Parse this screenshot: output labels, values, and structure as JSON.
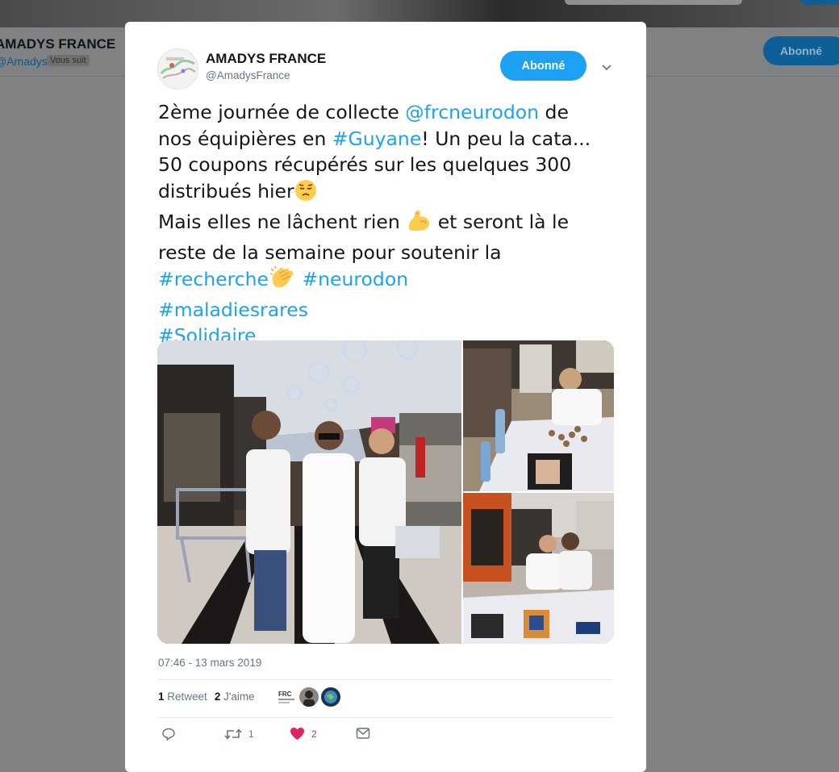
{
  "background": {
    "profile_name": "AMADYS FRANCE",
    "profile_handle": "@AmadysFrance",
    "follows_you": "Vous suit",
    "follow_button": "Abonné"
  },
  "tweet": {
    "author": {
      "name": "AMADYS FRANCE",
      "handle": "@AmadysFrance",
      "avatar_icon": "avatar-map-logo"
    },
    "follow_button": "Abonné",
    "lines": [
      [
        {
          "t": "2ème journée de collecte "
        },
        {
          "t": "@frcneurodon",
          "link": true
        },
        {
          "t": "  de"
        }
      ],
      [
        {
          "t": "nos équipières en "
        },
        {
          "t": "#Guyane",
          "link": true
        },
        {
          "t": "! Un peu la cata..."
        }
      ],
      [
        {
          "t": "50 coupons récupérés sur les quelques 300"
        }
      ],
      [
        {
          "t": "distribués hier"
        },
        {
          "emoji": "pensive-face"
        }
      ],
      [
        {
          "t": "Mais elles ne lâchent rien "
        },
        {
          "emoji": "flexed-biceps"
        },
        {
          "t": " et seront là le"
        }
      ],
      [
        {
          "t": "reste de la semaine pour soutenir la"
        }
      ],
      [
        {
          "t": "#recherche",
          "link": true
        },
        {
          "emoji": "clapping-hands"
        },
        {
          "t": " "
        },
        {
          "t": "#neurodon",
          "link": true
        }
      ],
      [
        {
          "t": "#maladiesrares",
          "link": true
        }
      ],
      [
        {
          "t": "#Solidaire",
          "link": true
        }
      ]
    ],
    "timestamp": "07:46 - 13 mars 2019",
    "stats": {
      "retweets_count": "1",
      "retweets_label": "Retweet",
      "likes_count": "2",
      "likes_label": "J'aime"
    },
    "liker_avatars": [
      "frc-logo",
      "person-avatar",
      "globe-avatar"
    ],
    "actions": {
      "reply_icon": "reply-icon",
      "retweet_icon": "retweet-icon",
      "retweet_count": "1",
      "like_icon": "heart-icon",
      "like_count": "2",
      "dm_icon": "envelope-icon"
    },
    "colors": {
      "accent": "#1da1f2",
      "like": "#e0245e",
      "secondary_text": "#657786",
      "overlay": "#7f8183"
    }
  }
}
